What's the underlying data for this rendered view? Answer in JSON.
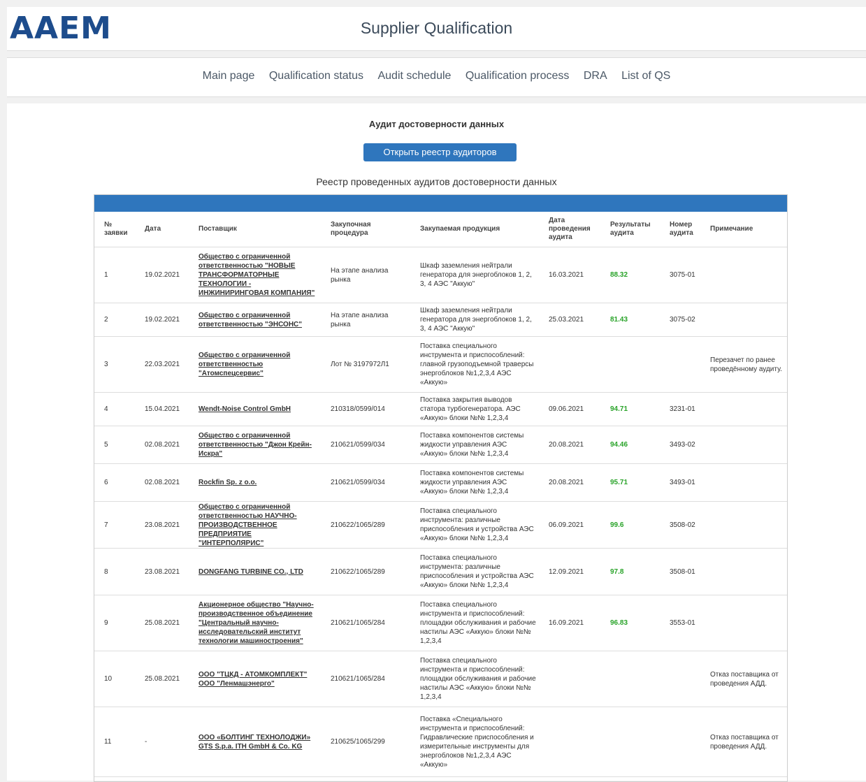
{
  "header": {
    "logo": "AAEM",
    "title": "Supplier Qualification"
  },
  "nav": [
    "Main page",
    "Qualification status",
    "Audit schedule",
    "Qualification process",
    "DRA",
    "List of QS"
  ],
  "page": {
    "section_title": "Аудит достоверности данных",
    "open_registry_button": "Открыть реестр аудиторов",
    "table_title": "Реестр проведенных аудитов достоверности данных"
  },
  "table": {
    "headers": [
      "№ заявки",
      "Дата",
      "Поставщик",
      "Закупочная процедура",
      "Закупаемая продукция",
      "Дата проведения аудита",
      "Результаты аудита",
      "Номер аудита",
      "Примечание"
    ],
    "rows": [
      [
        "1",
        "19.02.2021",
        "Общество с ограниченной ответственностью \"НОВЫЕ ТРАНСФОРМАТОРНЫЕ ТЕХНОЛОГИИ - ИНЖИНИРИНГОВАЯ КОМПАНИЯ\"",
        "На этапе анализа рынка",
        "Шкаф заземления нейтрали генератора для энергоблоков 1, 2, 3, 4 АЭС \"Аккую\"",
        "16.03.2021",
        "88.32",
        "3075-01",
        ""
      ],
      [
        "2",
        "19.02.2021",
        "Общество с ограниченной ответственностью \"ЭНСОНС\"",
        "На этапе анализа рынка",
        "Шкаф заземления нейтрали генератора для энергоблоков 1, 2, 3, 4 АЭС \"Аккую\"",
        "25.03.2021",
        "81.43",
        "3075-02",
        ""
      ],
      [
        "3",
        "22.03.2021",
        "Общество с ограниченной ответственностью \"Атомспецсервис\"",
        "Лот № 3197972Л1",
        "Поставка специального инструмента и приспособлений: главной грузоподъемной траверсы энергоблоков №1,2,3,4 АЭС «Аккую»",
        "",
        "",
        "",
        "Перезачет по ранее проведённому аудиту."
      ],
      [
        "4",
        "15.04.2021",
        "Wendt-Noise Control GmbH",
        "210318/0599/014",
        "Поставка закрытия выводов статора турбогенератора. АЭС «Аккую» блоки №№ 1,2,3,4",
        "09.06.2021",
        "94.71",
        "3231-01",
        ""
      ],
      [
        "5",
        "02.08.2021",
        "Общество с ограниченной ответственностью \"Джон Крейн-Искра\"",
        "210621/0599/034",
        "Поставка компонентов системы жидкости управления АЭС «Аккую» блоки №№ 1,2,3,4",
        "20.08.2021",
        "94.46",
        "3493-02",
        ""
      ],
      [
        "6",
        "02.08.2021",
        "Rockfin Sp. z o.o.",
        "210621/0599/034",
        "Поставка компонентов системы жидкости управления АЭС «Аккую» блоки №№ 1,2,3,4",
        "20.08.2021",
        "95.71",
        "3493-01",
        ""
      ],
      [
        "7",
        "23.08.2021",
        "Общество с ограниченной ответственностью НАУЧНО-ПРОИЗВОДСТВЕННОЕ ПРЕДПРИЯТИЕ \"ИНТЕРПОЛЯРИС\"",
        "210622/1065/289",
        "Поставка специального инструмента: различные приспособления и устройства АЭС «Аккую» блоки №№ 1,2,3,4",
        "06.09.2021",
        "99.6",
        "3508-02",
        ""
      ],
      [
        "8",
        "23.08.2021",
        "DONGFANG TURBINE CO., LTD",
        "210622/1065/289",
        "Поставка специального инструмента: различные приспособления и устройства АЭС «Аккую» блоки №№ 1,2,3,4",
        "12.09.2021",
        "97.8",
        "3508-01",
        ""
      ],
      [
        "9",
        "25.08.2021",
        "Акционерное общество \"Научно-производственное объединение \"Центральный научно-исследовательский институт технологии машиностроения\"",
        "210621/1065/284",
        "Поставка специального инструмента и приспособлений: площадки обслуживания и рабочие настилы АЭС «Аккую» блоки №№ 1,2,3,4",
        "16.09.2021",
        "96.83",
        "3553-01",
        ""
      ],
      [
        "10",
        "25.08.2021",
        "ООО \"ТЦКД - АТОМКОМПЛЕКТ\" ООО \"Ленмашэнерго\"",
        "210621/1065/284",
        "Поставка специального инструмента и приспособлений: площадки обслуживания и рабочие настилы АЭС «Аккую» блоки №№ 1,2,3,4",
        "",
        "",
        "",
        "Отказ поставщика от проведения АДД."
      ],
      [
        "11",
        "-",
        "ООО «БОЛТИНГ ТЕХНОЛОДЖИ» GTS S.p.a. ITH GmbH & Co. KG",
        "210625/1065/299",
        "Поставка «Специального инструмента и приспособлений: Гидравлические приспособления и измерительные инструменты для энергоблоков №1,2,3,4 АЭС «Аккую»",
        "",
        "",
        "",
        "Отказ поставщика от проведения АДД."
      ]
    ]
  }
}
